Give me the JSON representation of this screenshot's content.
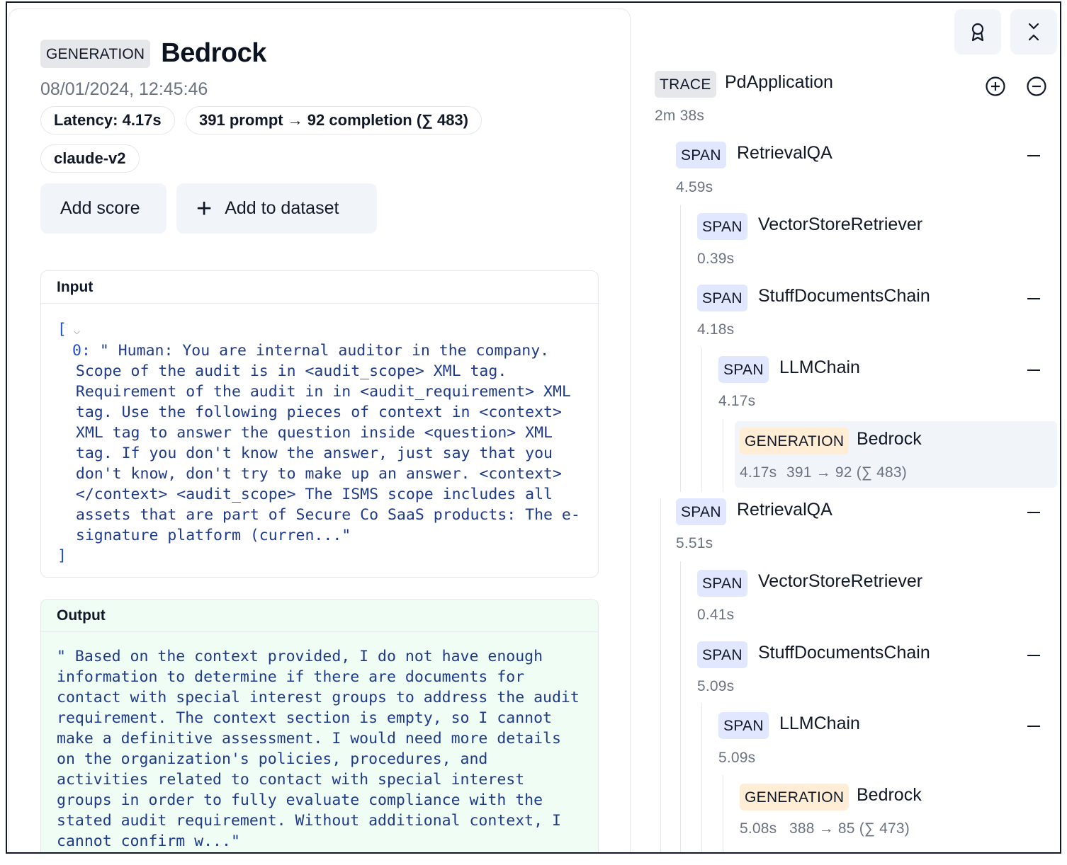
{
  "detail": {
    "type_badge": "GENERATION",
    "title": "Bedrock",
    "timestamp": "08/01/2024, 12:45:46",
    "latency": "Latency: 4.17s",
    "tokens": "391 prompt → 92 completion (∑ 483)",
    "model": "claude-v2",
    "add_score_label": "Add score",
    "add_dataset_label": "Add to dataset"
  },
  "input": {
    "header": "Input",
    "open_bracket": "[",
    "close_bracket": "]",
    "index": "0:",
    "lines": [
      "\" Human: You are internal auditor in the company.",
      "Scope of the audit is in <audit_scope> XML tag.",
      "Requirement of the audit in in <audit_requirement> XML",
      "tag. Use the following pieces of context in <context>",
      "XML tag to answer the question inside <question> XML",
      "tag. If you don't know the answer, just say that you",
      "don't know, don't try to make up an answer. <context>",
      "</context> <audit_scope> The ISMS scope includes all",
      "assets that are part of Secure Co SaaS products: The e-",
      "signature platform (curren...\""
    ]
  },
  "output": {
    "header": "Output",
    "lines": [
      "\" Based on the context provided, I do not have enough",
      "information to determine if there are documents for",
      "contact with special interest groups to address the audit",
      "requirement. The context section is empty, so I cannot",
      "make a definitive assessment. I would need more details",
      "on the organization's policies, procedures, and",
      "activities related to contact with special interest",
      "groups in order to fully evaluate compliance with the",
      "stated audit requirement. Without additional context, I",
      "cannot confirm w...\""
    ]
  },
  "trace": {
    "root": {
      "tag": "TRACE",
      "name": "PdApplication",
      "meta": "2m 38s"
    },
    "nodes": [
      {
        "tag": "SPAN",
        "name": "RetrievalQA",
        "meta": "4.59s"
      },
      {
        "tag": "SPAN",
        "name": "VectorStoreRetriever",
        "meta": "0.39s"
      },
      {
        "tag": "SPAN",
        "name": "StuffDocumentsChain",
        "meta": "4.18s"
      },
      {
        "tag": "SPAN",
        "name": "LLMChain",
        "meta": "4.17s"
      },
      {
        "tag": "GENERATION",
        "name": "Bedrock",
        "meta": "4.17s",
        "tokens": "391 → 92 (∑ 483)"
      },
      {
        "tag": "SPAN",
        "name": "RetrievalQA",
        "meta": "5.51s"
      },
      {
        "tag": "SPAN",
        "name": "VectorStoreRetriever",
        "meta": "0.41s"
      },
      {
        "tag": "SPAN",
        "name": "StuffDocumentsChain",
        "meta": "5.09s"
      },
      {
        "tag": "SPAN",
        "name": "LLMChain",
        "meta": "5.09s"
      },
      {
        "tag": "GENERATION",
        "name": "Bedrock",
        "meta": "5.08s",
        "tokens": "388 → 85 (∑ 473)"
      }
    ]
  },
  "icons": {
    "award": "award-icon",
    "collapse": "collapse-icon",
    "expand_all": "plus-circle-icon",
    "collapse_all": "minus-circle-icon"
  }
}
